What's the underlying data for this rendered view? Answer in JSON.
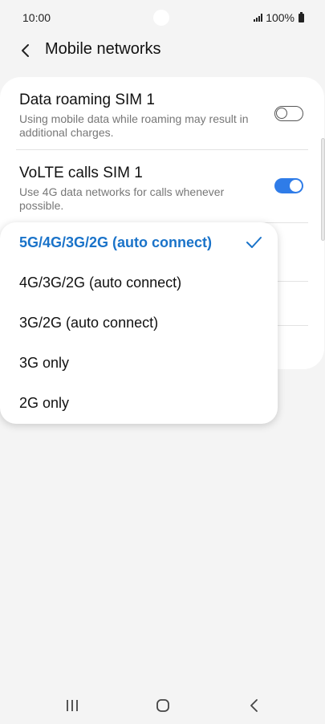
{
  "status_bar": {
    "time": "10:00",
    "battery": "100%",
    "icons": [
      "camera-hole",
      "signal-icon",
      "battery-icon"
    ]
  },
  "header": {
    "back_icon": "back-arrow-icon",
    "title": "Mobile networks"
  },
  "settings": [
    {
      "title": "Data roaming SIM 1",
      "description": "Using mobile data while roaming may result in additional charges.",
      "toggle": "off"
    },
    {
      "title": "VoLTE calls SIM 1",
      "description": "Use 4G data networks for calls whenever possible.",
      "toggle": "on"
    }
  ],
  "network_mode_menu": {
    "options": [
      {
        "label": "5G/4G/3G/2G (auto connect)",
        "selected": true
      },
      {
        "label": "4G/3G/2G (auto connect)",
        "selected": false
      },
      {
        "label": "3G/2G (auto connect)",
        "selected": false
      },
      {
        "label": "3G only",
        "selected": false
      },
      {
        "label": "2G only",
        "selected": false
      }
    ],
    "check_icon": "checkmark-icon"
  },
  "nav_bar": {
    "buttons": [
      "recents-icon",
      "home-icon",
      "back-icon"
    ]
  },
  "colors": {
    "accent": "#1a73c9",
    "toggle_on": "#2f7ce8",
    "background": "#f4f4f4",
    "card": "#ffffff"
  }
}
